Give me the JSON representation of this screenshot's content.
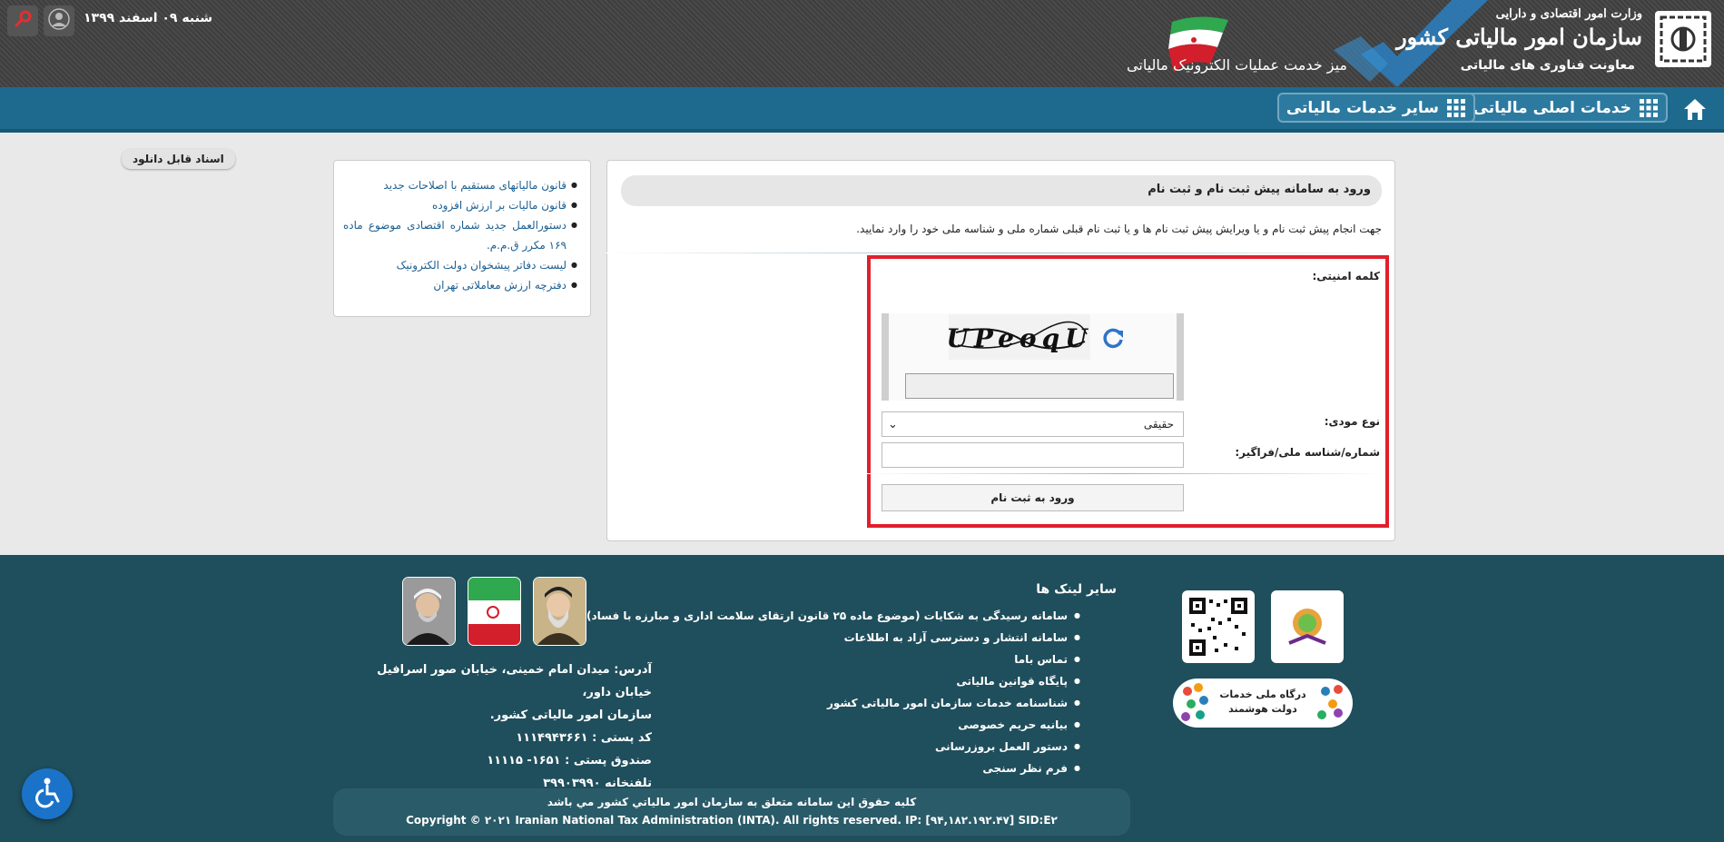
{
  "header": {
    "ministry": "وزارت امور اقتصادی و دارایی",
    "org_name": "سازمان امور مالیاتی کشور",
    "deputy": "معاونت فناوری های مالیاتی",
    "service_desk": "میز خدمت عملیات الکترونیک مالیاتی",
    "date": "شنبه ۰۹ اسفند ۱۳۹۹"
  },
  "nav": {
    "main_services": "خدمات اصلی مالیاتی",
    "other_services": "سایر خدمات مالیاتی"
  },
  "login_panel": {
    "title": "ورود به سامانه پیش ثبت نام و ثبت نام",
    "description": "جهت انجام پیش ثبت نام و یا ویرایش پیش ثبت نام ها و یا ثبت نام قبلی شماره ملی و شناسه ملی خود را وارد نمایید.",
    "captcha_label": "کلمه امنیتی:",
    "captcha_text": "UPeoqU",
    "taxpayer_type_label": "نوع مودی:",
    "taxpayer_type_value": "حقیقی",
    "national_id_label": "شماره/شناسه ملی/فراگیر:",
    "submit_label": "ورود به ثبت نام"
  },
  "downloads": {
    "title": "اسناد قابل دانلود",
    "items": [
      "قانون مالیاتهای مستقیم با اصلاحات جدید",
      "قانون مالیات بر ارزش افزوده",
      "دستورالعمل جدید شماره اقتصادی موضوع ماده ۱۶۹ مکرر ق.م.م.",
      "لیست دفاتر پیشخوان دولت الکترونیک",
      "دفترچه ارزش معاملاتی تهران"
    ]
  },
  "footer": {
    "links_title": "سایر لینک ها",
    "links": [
      "سامانه رسیدگی به شکایات (موضوع ماده ۲۵ قانون ارتقای سلامت اداری و مبارزه با فساد)",
      "سامانه انتشار و دسترسی آزاد به اطلاعات",
      "تماس باما",
      "پایگاه قوانین مالیاتی",
      "شناسنامه خدمات سازمان امور مالیاتی کشور",
      "بیانیه حریم خصوصی",
      "دستور العمل بروزرسانی",
      "فرم نظر سنجی"
    ],
    "smart_gov": "درگاه ملی خدمات دولت هوشمند",
    "address_line1": "آدرس: میدان امام خمینی، خیابان صور اسرافیل خیابان داور،",
    "address_line2": "سازمان امور مالیاتی کشور.",
    "postal_code": "کد پستی : ۱۱۱۴۹۴۳۶۶۱",
    "po_box": "صندوق پستی : ۱۶۵۱- ۱۱۱۱۵",
    "phone": "تلفنخانه ۳۹۹۰۳۹۹۰",
    "copyright_fa": "کلیه حقوق این سامانه متعلق به سازمان امور مالیاتي کشور مي باشد",
    "copyright_en": "Copyright © ۲۰۲۱ Iranian National Tax Administration (INTA). All rights reserved. IP: [۹۴,۱۸۲.۱۹۲.۴۷] SID:E۲"
  },
  "colors": {
    "nav_blue": "#1e6a8f",
    "footer_teal": "#1f4e5c",
    "highlight_red": "#e0202c",
    "link_blue": "#1c5f91"
  }
}
